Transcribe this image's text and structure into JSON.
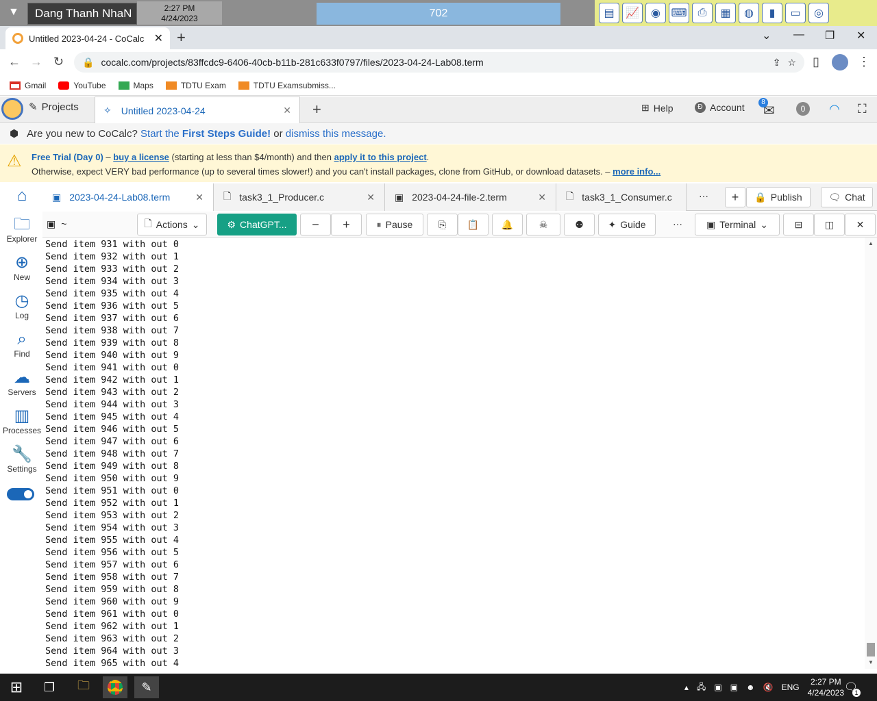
{
  "top_strip": {
    "user_name": "Dang Thanh NhaN",
    "time": "2:27 PM",
    "date": "4/24/2023",
    "counter": "702"
  },
  "browser": {
    "tab_title": "Untitled 2023-04-24 - CoCalc",
    "url": "cocalc.com/projects/83ffcdc9-6406-40cb-b11b-281c633f0797/files/2023-04-24-Lab08.term",
    "bookmarks": [
      "Gmail",
      "YouTube",
      "Maps",
      "TDTU Exam",
      "TDTU Examsubmiss..."
    ]
  },
  "cocalc_nav": {
    "projects_label": "Projects",
    "project_tab": "Untitled 2023-04-24",
    "help": "Help",
    "account": "Account",
    "notif_badge": "8",
    "counter": "0"
  },
  "new_user_msg": {
    "prefix": "Are you new to CoCalc?",
    "start": "Start the",
    "guide": "First Steps Guide!",
    "or": "or",
    "dismiss": "dismiss this message."
  },
  "trial": {
    "free_trial": "Free Trial (Day 0)",
    "dash": "–",
    "buy": "buy a license",
    "mid": "(starting at less than $4/month) and then",
    "apply": "apply it to this project",
    "line2": "Otherwise, expect VERY bad performance (up to several times slower!) and you can't install packages, clone from GitHub, or download datasets. –",
    "more": "more info..."
  },
  "sidebar": {
    "items": [
      "Explorer",
      "New",
      "Log",
      "Find",
      "Servers",
      "Processes",
      "Settings"
    ]
  },
  "file_tabs": {
    "tabs": [
      "2023-04-24-Lab08.term",
      "task3_1_Producer.c",
      "2023-04-24-file-2.term",
      "task3_1_Consumer.c"
    ],
    "more": "···",
    "publish": "Publish",
    "chat": "Chat"
  },
  "term_toolbar": {
    "path": "~",
    "actions": "Actions",
    "chatgpt": "ChatGPT...",
    "pause": "Pause",
    "guide": "Guide",
    "more": "···",
    "terminal": "Terminal"
  },
  "terminal_lines": [
    "Send item 931 with out 0",
    "Send item 932 with out 1",
    "Send item 933 with out 2",
    "Send item 934 with out 3",
    "Send item 935 with out 4",
    "Send item 936 with out 5",
    "Send item 937 with out 6",
    "Send item 938 with out 7",
    "Send item 939 with out 8",
    "Send item 940 with out 9",
    "Send item 941 with out 0",
    "Send item 942 with out 1",
    "Send item 943 with out 2",
    "Send item 944 with out 3",
    "Send item 945 with out 4",
    "Send item 946 with out 5",
    "Send item 947 with out 6",
    "Send item 948 with out 7",
    "Send item 949 with out 8",
    "Send item 950 with out 9",
    "Send item 951 with out 0",
    "Send item 952 with out 1",
    "Send item 953 with out 2",
    "Send item 954 with out 3",
    "Send item 955 with out 4",
    "Send item 956 with out 5",
    "Send item 957 with out 6",
    "Send item 958 with out 7",
    "Send item 959 with out 8",
    "Send item 960 with out 9",
    "Send item 961 with out 0",
    "Send item 962 with out 1",
    "Send item 963 with out 2",
    "Send item 964 with out 3",
    "Send item 965 with out 4"
  ],
  "taskbar": {
    "lang": "ENG",
    "time": "2:27 PM",
    "date": "4/24/2023",
    "notif_count": "1"
  }
}
